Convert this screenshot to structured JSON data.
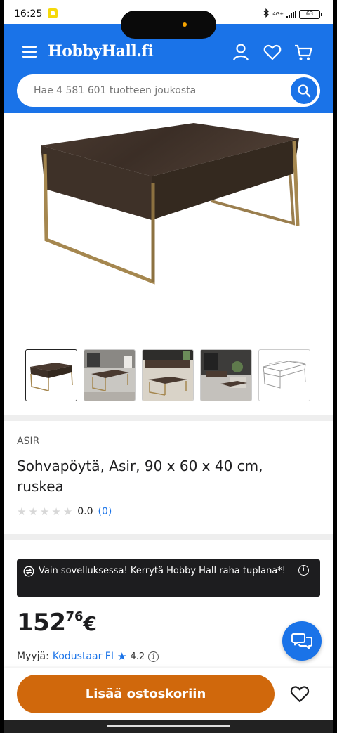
{
  "status_bar": {
    "time": "16:25",
    "network": "4G+",
    "battery": "63"
  },
  "header": {
    "logo": "HobbyHall.fi",
    "icons": [
      "menu-icon",
      "user-icon",
      "heart-icon",
      "cart-icon"
    ]
  },
  "search": {
    "placeholder": "Hae 4 581 601 tuotteen joukosta"
  },
  "gallery": {
    "thumbnail_count": 5,
    "selected_index": 0
  },
  "product": {
    "brand": "ASIR",
    "title": "Sohvapöytä, Asir, 90 x 60 x 40 cm, ruskea",
    "rating_value": "0.0",
    "rating_count": "(0)",
    "stars_filled": 0,
    "stars_total": 5
  },
  "promo": {
    "text": "Vain sovelluksessa! Kerrytä Hobby Hall raha tuplana*!",
    "info": "i"
  },
  "price": {
    "integer": "152",
    "decimals": "76",
    "currency": "€"
  },
  "seller": {
    "label": "Myyjä:",
    "name": "Kodustaar FI",
    "rating": "4.2",
    "info": "i"
  },
  "actions": {
    "add_to_cart": "Lisää ostoskoriin"
  },
  "colors": {
    "primary": "#1a73e8",
    "cta": "#d0680c",
    "promo_bg": "#1d1d1f"
  }
}
